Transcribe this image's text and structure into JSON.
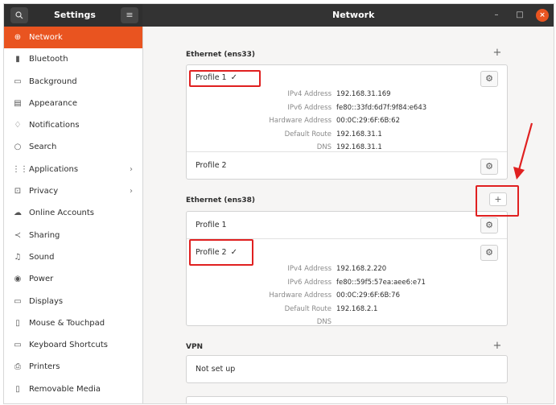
{
  "header": {
    "search_icon": "search-icon",
    "sidebar_title": "Settings",
    "menu_icon": "hamburger-icon",
    "title": "Network",
    "minimize": "–",
    "maximize": "□",
    "close": "×"
  },
  "sidebar": {
    "items": [
      {
        "label": "Network",
        "icon": "network-icon",
        "glyph": "⊕",
        "active": true
      },
      {
        "label": "Bluetooth",
        "icon": "bluetooth-icon",
        "glyph": "▮"
      },
      {
        "label": "Background",
        "icon": "background-icon",
        "glyph": "▭"
      },
      {
        "label": "Appearance",
        "icon": "appearance-icon",
        "glyph": "▤"
      },
      {
        "label": "Notifications",
        "icon": "notifications-icon",
        "glyph": "♢"
      },
      {
        "label": "Search",
        "icon": "search-icon",
        "glyph": "○"
      },
      {
        "label": "Applications",
        "icon": "applications-icon",
        "glyph": "⋮⋮",
        "chevron": "›"
      },
      {
        "label": "Privacy",
        "icon": "privacy-icon",
        "glyph": "⊡",
        "chevron": "›"
      },
      {
        "label": "Online Accounts",
        "icon": "online-accounts-icon",
        "glyph": "☁"
      },
      {
        "label": "Sharing",
        "icon": "sharing-icon",
        "glyph": "≺"
      },
      {
        "label": "Sound",
        "icon": "sound-icon",
        "glyph": "♫"
      },
      {
        "label": "Power",
        "icon": "power-icon",
        "glyph": "◉"
      },
      {
        "label": "Displays",
        "icon": "displays-icon",
        "glyph": "▭"
      },
      {
        "label": "Mouse & Touchpad",
        "icon": "mouse-icon",
        "glyph": "▯"
      },
      {
        "label": "Keyboard Shortcuts",
        "icon": "keyboard-icon",
        "glyph": "▭"
      },
      {
        "label": "Printers",
        "icon": "printer-icon",
        "glyph": "⎙"
      },
      {
        "label": "Removable Media",
        "icon": "removable-media-icon",
        "glyph": "▯"
      }
    ]
  },
  "ethernet1": {
    "title": "Ethernet (ens33)",
    "add": "+",
    "profile1": {
      "name": "Profile 1",
      "check": "✓",
      "details": [
        {
          "key": "IPv4 Address",
          "value": "192.168.31.169"
        },
        {
          "key": "IPv6 Address",
          "value": "fe80::33fd:6d7f:9f84:e643"
        },
        {
          "key": "Hardware Address",
          "value": "00:0C:29:6F:6B:62"
        },
        {
          "key": "Default Route",
          "value": "192.168.31.1"
        },
        {
          "key": "DNS",
          "value": "192.168.31.1"
        }
      ]
    },
    "profile2": {
      "name": "Profile 2"
    }
  },
  "ethernet2": {
    "title": "Ethernet (ens38)",
    "add": "+",
    "profile1": {
      "name": "Profile 1"
    },
    "profile2": {
      "name": "Profile 2",
      "check": "✓",
      "details": [
        {
          "key": "IPv4 Address",
          "value": "192.168.2.220"
        },
        {
          "key": "IPv6 Address",
          "value": "fe80::59f5:57ea:aee6:e71"
        },
        {
          "key": "Hardware Address",
          "value": "00:0C:29:6F:6B:76"
        },
        {
          "key": "Default Route",
          "value": "192.168.2.1"
        },
        {
          "key": "DNS",
          "value": ""
        }
      ]
    }
  },
  "vpn": {
    "title": "VPN",
    "add": "+",
    "empty": "Not set up"
  },
  "colors": {
    "accent": "#e95420",
    "annotation": "#e02020"
  }
}
